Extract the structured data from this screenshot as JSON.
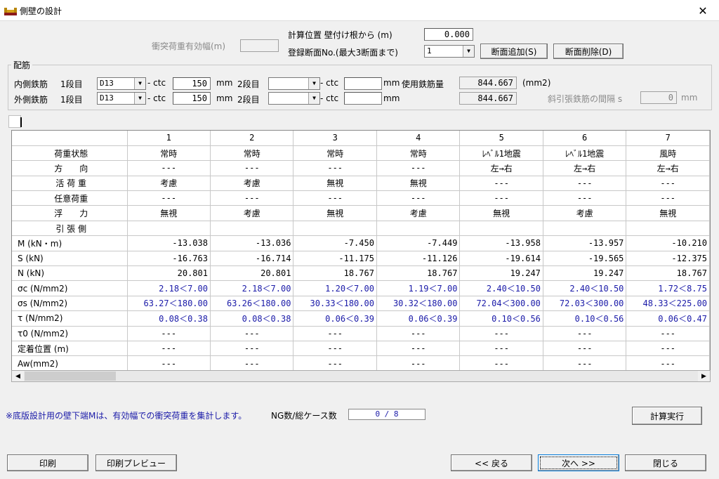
{
  "window": {
    "title": "側壁の設計",
    "close_glyph": "✕"
  },
  "top": {
    "impact_label": "衝突荷重有効幅(m)",
    "impact_value": "",
    "calc_pos_label": "計算位置 壁付け根から (m)",
    "calc_pos_value": "0.000",
    "section_no_label": "登録断面No.(最大3断面まで)",
    "section_no_value": "1",
    "add_section_button": "断面追加(S)",
    "delete_section_button": "断面削除(D)"
  },
  "rebar": {
    "group_title": "配筋",
    "inner_label": "内側鉄筋",
    "outer_label": "外側鉄筋",
    "stage1_label": "1段目",
    "stage2_label": "2段目",
    "inner_bar": "D13",
    "outer_bar": "D13",
    "ctc_label": "- ctc",
    "inner_ctc": "150",
    "outer_ctc": "150",
    "mm_label": "mm",
    "inner_stage2_bar": "",
    "outer_stage2_bar": "",
    "inner_stage2_ctc": "",
    "outer_stage2_ctc": "",
    "used_label": "使用鉄筋量",
    "used_inner": "844.667",
    "used_outer": "844.667",
    "unit_mm2": "(mm2)",
    "diag_label": "斜引張鉄筋の間隔 s",
    "diag_value": "0",
    "diag_unit": "mm"
  },
  "grid": {
    "columns": [
      "1",
      "2",
      "3",
      "4",
      "5",
      "6",
      "7"
    ],
    "rows": [
      {
        "label": "荷重状態",
        "center": true,
        "type": "val",
        "cells": [
          "常時",
          "常時",
          "常時",
          "常時",
          "ﾚﾍﾞﾙ1地震",
          "ﾚﾍﾞﾙ1地震",
          "風時"
        ]
      },
      {
        "label": "方　　向",
        "center": true,
        "type": "val",
        "cells": [
          "---",
          "---",
          "---",
          "---",
          "左→右",
          "左→右",
          "左→右"
        ]
      },
      {
        "label": "活 荷 重",
        "center": true,
        "type": "val",
        "cells": [
          "考慮",
          "考慮",
          "無視",
          "無視",
          "---",
          "---",
          "---"
        ]
      },
      {
        "label": "任意荷重",
        "center": true,
        "type": "val",
        "cells": [
          "---",
          "---",
          "---",
          "---",
          "---",
          "---",
          "---"
        ]
      },
      {
        "label": "浮　　力",
        "center": true,
        "type": "val",
        "cells": [
          "無視",
          "考慮",
          "無視",
          "考慮",
          "無視",
          "考慮",
          "無視"
        ]
      },
      {
        "label": "引 張 側",
        "center": true,
        "type": "val",
        "cells": [
          "",
          "",
          "",
          "",
          "",
          "",
          ""
        ]
      },
      {
        "label": "M (kN・m)",
        "center": false,
        "type": "num",
        "cells": [
          "-13.038",
          "-13.036",
          "-7.450",
          "-7.449",
          "-13.958",
          "-13.957",
          "-10.210"
        ]
      },
      {
        "label": "S (kN)",
        "center": false,
        "type": "num",
        "cells": [
          "-16.763",
          "-16.714",
          "-11.175",
          "-11.126",
          "-19.614",
          "-19.565",
          "-12.375"
        ]
      },
      {
        "label": "N (kN)",
        "center": false,
        "type": "num",
        "cells": [
          "20.801",
          "20.801",
          "18.767",
          "18.767",
          "19.247",
          "19.247",
          "18.767"
        ]
      },
      {
        "label": "σc (N/mm2)",
        "center": false,
        "type": "blue",
        "cells": [
          "2.18＜7.00",
          "2.18＜7.00",
          "1.20＜7.00",
          "1.19＜7.00",
          "2.40＜10.50",
          "2.40＜10.50",
          "1.72＜8.75"
        ]
      },
      {
        "label": "σs (N/mm2)",
        "center": false,
        "type": "blue",
        "cells": [
          "63.27＜180.00",
          "63.26＜180.00",
          "30.33＜180.00",
          "30.32＜180.00",
          "72.04＜300.00",
          "72.03＜300.00",
          "48.33＜225.00"
        ]
      },
      {
        "label": "τ (N/mm2)",
        "center": false,
        "type": "blue",
        "cells": [
          "0.08＜0.38",
          "0.08＜0.38",
          "0.06＜0.39",
          "0.06＜0.39",
          "0.10＜0.56",
          "0.10＜0.56",
          "0.06＜0.47"
        ]
      },
      {
        "label": "τ0 (N/mm2)",
        "center": false,
        "type": "val",
        "cells": [
          "---",
          "---",
          "---",
          "---",
          "---",
          "---",
          "---"
        ]
      },
      {
        "label": "定着位置 (m)",
        "center": false,
        "type": "val",
        "cells": [
          "---",
          "---",
          "---",
          "---",
          "---",
          "---",
          "---"
        ]
      },
      {
        "label": "Aw(mm2)",
        "center": false,
        "type": "val",
        "cells": [
          "---",
          "---",
          "---",
          "---",
          "---",
          "---",
          "---"
        ]
      }
    ]
  },
  "footer": {
    "note": "※底版設計用の壁下端Mは、有効幅での衝突荷重を集計します。",
    "ng_label": "NG数/総ケース数",
    "ng_value": "0 / 8",
    "calc_button": "計算実行",
    "print_button": "印刷",
    "preview_button": "印刷プレビュー",
    "back_button": "<< 戻る",
    "next_button": "次へ >>",
    "close_button": "閉じる",
    "note_color": "#1a1aa8"
  }
}
